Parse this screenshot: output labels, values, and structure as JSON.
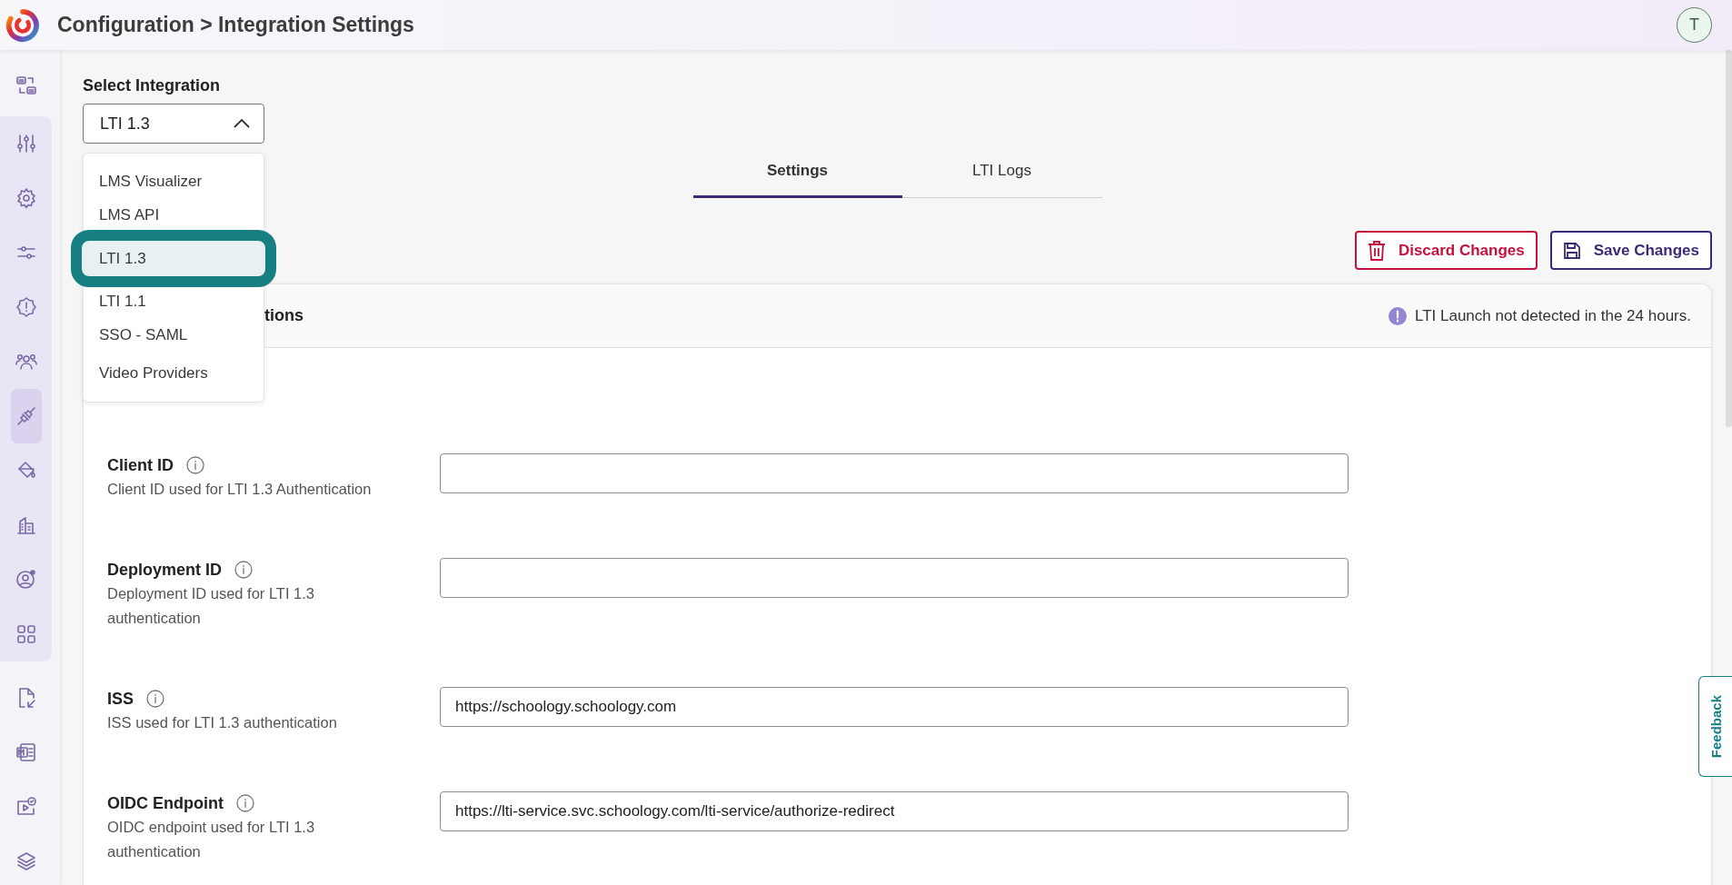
{
  "header": {
    "title": "Configuration > Integration Settings",
    "avatar": "T"
  },
  "sidebar": {
    "top": [
      {
        "kind": "swap",
        "selected": false
      }
    ],
    "group": [
      {
        "kind": "sliders",
        "selected": false
      },
      {
        "kind": "gear",
        "selected": false
      },
      {
        "kind": "slider",
        "selected": false
      },
      {
        "kind": "alert",
        "selected": false
      },
      {
        "kind": "people",
        "selected": false
      },
      {
        "kind": "plug",
        "selected": true
      },
      {
        "kind": "bucket",
        "selected": false
      },
      {
        "kind": "building",
        "selected": false
      },
      {
        "kind": "usergear",
        "selected": false
      },
      {
        "kind": "grid",
        "selected": false
      }
    ],
    "bottom": [
      {
        "kind": "fileimport",
        "selected": false
      },
      {
        "kind": "doc",
        "selected": false
      },
      {
        "kind": "video",
        "selected": false
      },
      {
        "kind": "layers",
        "selected": false
      }
    ]
  },
  "integration": {
    "label": "Select Integration",
    "value": "LTI 1.3",
    "expanded": true,
    "options": [
      {
        "label": "LMS Visualizer",
        "selected": false
      },
      {
        "label": "LMS API",
        "selected": false
      },
      {
        "label": "LTI 1.3",
        "selected": true
      },
      {
        "label": "LTI 1.1",
        "selected": false
      },
      {
        "label": "SSO - SAML",
        "selected": false
      },
      {
        "label": "Video Providers",
        "selected": false
      }
    ]
  },
  "tabs": [
    {
      "label": "Settings",
      "selected": true
    },
    {
      "label": "LTI Logs",
      "selected": false
    }
  ],
  "buttons": [
    {
      "kind": "discard",
      "label": "Discard Changes"
    },
    {
      "kind": "save",
      "label": "Save Changes"
    }
  ],
  "card": {
    "title": "tions",
    "notice": "LTI Launch not detected in the 24 hours.",
    "fields": [
      {
        "label": "Client ID",
        "description": "Client ID used for LTI 1.3 Authentication"
      },
      {
        "label": "Deployment ID",
        "description": "Deployment ID used for LTI 1.3 authentication"
      },
      {
        "label": "ISS",
        "description": "ISS used for LTI 1.3 authentication",
        "value": "https://schoology.schoology.com"
      },
      {
        "label": "OIDC Endpoint",
        "description": "OIDC endpoint used for LTI 1.3 authentication",
        "value": "https://lti-service.svc.schoology.com/lti-service/authorize-redirect"
      }
    ]
  },
  "feedback": "Feedback"
}
